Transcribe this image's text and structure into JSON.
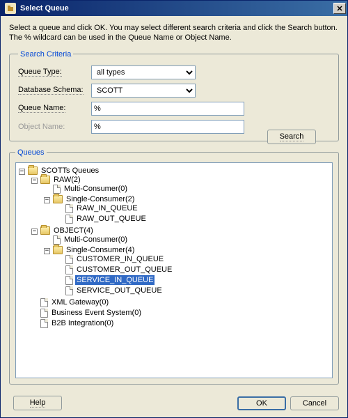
{
  "title": "Select Queue",
  "instructions": "Select a queue and click OK. You may select different search criteria and click the Search button. The % wildcard can be used in the Queue Name or Object Name.",
  "search_criteria": {
    "legend": "Search Criteria",
    "queue_type": {
      "label": "Queue Type:",
      "value": "all types"
    },
    "database_schema": {
      "label": "Database Schema:",
      "value": "SCOTT"
    },
    "queue_name": {
      "label": "Queue Name:",
      "value": "%"
    },
    "object_name": {
      "label": "Object Name:",
      "value": "%"
    },
    "search_button": "Search"
  },
  "queues": {
    "legend": "Queues",
    "tree": [
      {
        "label": "SCOTTs Queues",
        "icon": "folder",
        "expanded": true,
        "children": [
          {
            "label": "RAW(2)",
            "icon": "folder",
            "expanded": true,
            "children": [
              {
                "label": "Multi-Consumer(0)",
                "icon": "file"
              },
              {
                "label": "Single-Consumer(2)",
                "icon": "folder",
                "expanded": true,
                "children": [
                  {
                    "label": "RAW_IN_QUEUE",
                    "icon": "file"
                  },
                  {
                    "label": "RAW_OUT_QUEUE",
                    "icon": "file"
                  }
                ]
              }
            ]
          },
          {
            "label": "OBJECT(4)",
            "icon": "folder",
            "expanded": true,
            "children": [
              {
                "label": "Multi-Consumer(0)",
                "icon": "file"
              },
              {
                "label": "Single-Consumer(4)",
                "icon": "folder",
                "expanded": true,
                "children": [
                  {
                    "label": "CUSTOMER_IN_QUEUE",
                    "icon": "file"
                  },
                  {
                    "label": "CUSTOMER_OUT_QUEUE",
                    "icon": "file"
                  },
                  {
                    "label": "SERVICE_IN_QUEUE",
                    "icon": "file",
                    "selected": true
                  },
                  {
                    "label": "SERVICE_OUT_QUEUE",
                    "icon": "file"
                  }
                ]
              }
            ]
          },
          {
            "label": "XML Gateway(0)",
            "icon": "file"
          },
          {
            "label": "Business Event System(0)",
            "icon": "file"
          },
          {
            "label": "B2B Integration(0)",
            "icon": "file"
          }
        ]
      }
    ]
  },
  "buttons": {
    "help": "Help",
    "ok": "OK",
    "cancel": "Cancel"
  }
}
